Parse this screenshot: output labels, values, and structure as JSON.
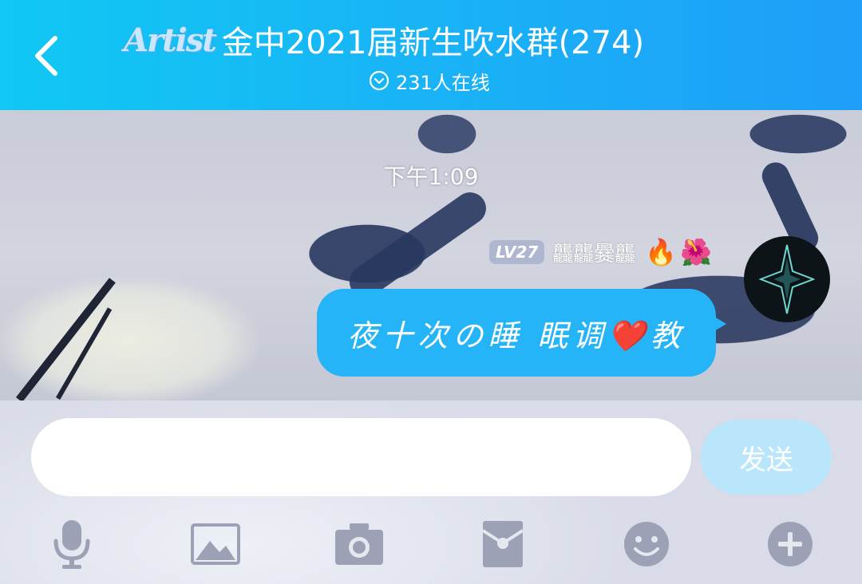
{
  "header": {
    "logo_text": "Artist",
    "title": "金中2021届新生吹水群(274)",
    "online_text": "231人在线"
  },
  "chat": {
    "timestamp": "下午1:09",
    "messages": [
      {
        "level": "LV27",
        "sender": "龘龘爨龘",
        "badges": [
          "🔥",
          "🌺"
        ],
        "text": "夜十次の睡 眠调❤️教"
      }
    ]
  },
  "input": {
    "placeholder": "",
    "value": "",
    "send_label": "发送"
  },
  "toolbar": {
    "items": [
      {
        "icon": "microphone-icon"
      },
      {
        "icon": "image-icon"
      },
      {
        "icon": "camera-icon"
      },
      {
        "icon": "red-packet-icon"
      },
      {
        "icon": "emoji-icon"
      },
      {
        "icon": "plus-icon"
      }
    ]
  },
  "colors": {
    "header_start": "#10c8f3",
    "header_end": "#1e9ef8",
    "bubble": "#24b4f7",
    "send_button": "#b9e6fb",
    "toolbar_icon": "#9da1b6"
  }
}
